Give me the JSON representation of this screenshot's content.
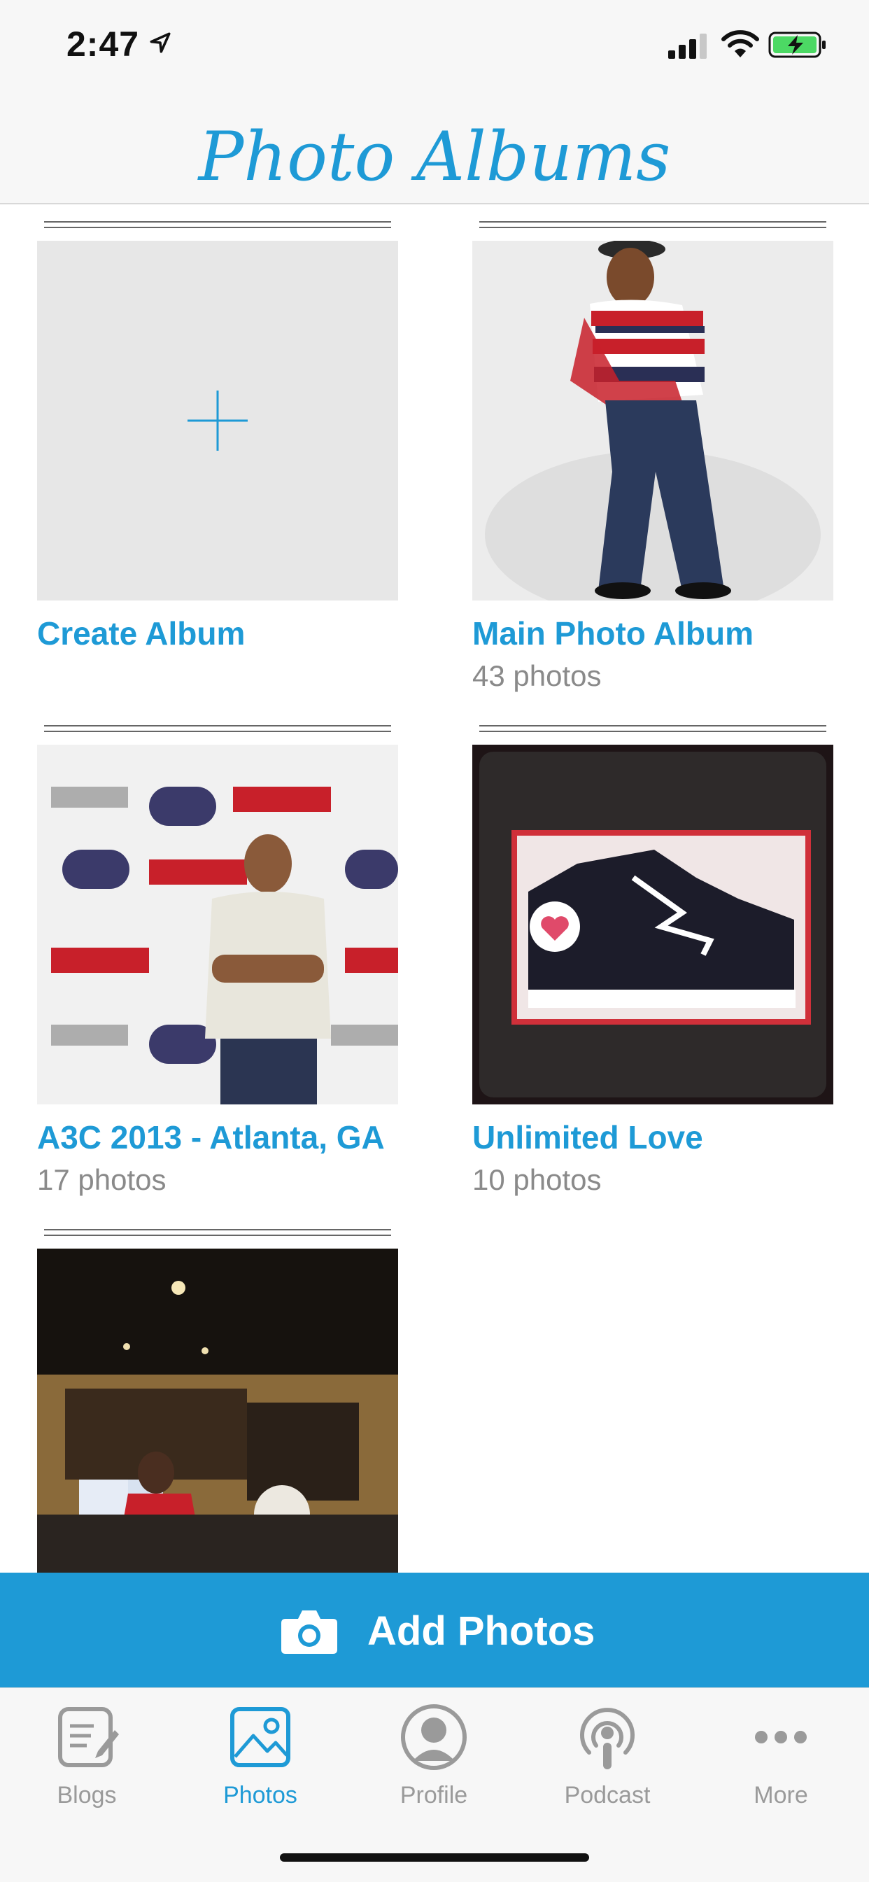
{
  "status": {
    "time": "2:47",
    "icons": [
      "location-arrow-icon",
      "cellular-signal-icon",
      "wifi-icon",
      "battery-charging-icon"
    ]
  },
  "header": {
    "title": "Photo Albums"
  },
  "albums": [
    {
      "name": "Create Album",
      "count": "",
      "image": "plus-placeholder"
    },
    {
      "name": "Main Photo Album",
      "count": "43 photos",
      "image": "man-in-striped-sweater-photo"
    },
    {
      "name": "A3C 2013 - Atlanta, GA",
      "count": "17 photos",
      "image": "man-at-step-and-repeat-backdrop-photo"
    },
    {
      "name": "Unlimited Love",
      "count": "10 photos",
      "image": "sneaker-in-box-photo"
    },
    {
      "name": "",
      "count": "",
      "image": "recording-studio-photo"
    }
  ],
  "add_photos": {
    "label": "Add Photos",
    "icon": "camera-icon"
  },
  "tabs": [
    {
      "label": "Blogs",
      "icon": "blogs-icon",
      "active": false
    },
    {
      "label": "Photos",
      "icon": "photos-icon",
      "active": true
    },
    {
      "label": "Profile",
      "icon": "profile-icon",
      "active": false
    },
    {
      "label": "Podcast",
      "icon": "podcast-icon",
      "active": false
    },
    {
      "label": "More",
      "icon": "more-icon",
      "active": false
    }
  ],
  "colors": {
    "accent": "#1e9ad6",
    "muted": "#9a9a9a",
    "battery": "#4cd964"
  }
}
